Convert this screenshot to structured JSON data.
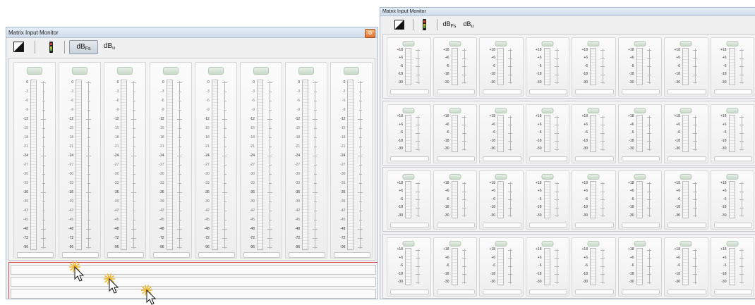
{
  "left_window": {
    "title": "Matrix Input Monitor",
    "title_button_icon": "gear-icon",
    "toolbar": {
      "contrast_icon": "contrast-icon",
      "meter_icon": "level-meter-icon",
      "dbfs_main": "dB",
      "dbfs_sub": "Fs",
      "dbu_main": "dB",
      "dbu_sub": "u",
      "active_unit": "dBFs"
    },
    "channel_count": 8,
    "scale_labels": [
      "0",
      "-3",
      "-6",
      "-9",
      "-12",
      "-15",
      "-18",
      "-21",
      "-24",
      "-27",
      "-30",
      "-33",
      "-36",
      "-39",
      "-42",
      "-45",
      "-48",
      "-72",
      "-96"
    ],
    "major_labels": [
      "0",
      "-12",
      "-24",
      "-36",
      "-48",
      "-72",
      "-96"
    ],
    "empty_rows": 3
  },
  "right_window": {
    "title": "Matrix Input Monitor",
    "toolbar": {
      "contrast_icon": "contrast-icon",
      "meter_icon": "level-meter-icon",
      "dbfs_main": "dB",
      "dbfs_sub": "Fs",
      "dbu_main": "dB",
      "dbu_sub": "u"
    },
    "group_rows": 4,
    "visible_columns": 8,
    "scale_labels": [
      "+18",
      "+6",
      "-6",
      "-18",
      "-30"
    ]
  },
  "cursors": [
    {
      "icon": "click-cursor-icon"
    },
    {
      "icon": "click-cursor-icon"
    },
    {
      "icon": "click-cursor-icon"
    }
  ],
  "colors": {
    "titlebar_top": "#e5eef8",
    "highlight_border": "#d94848",
    "meter_button": "#c8d8c8",
    "cursor_burst": "#f0b830"
  }
}
